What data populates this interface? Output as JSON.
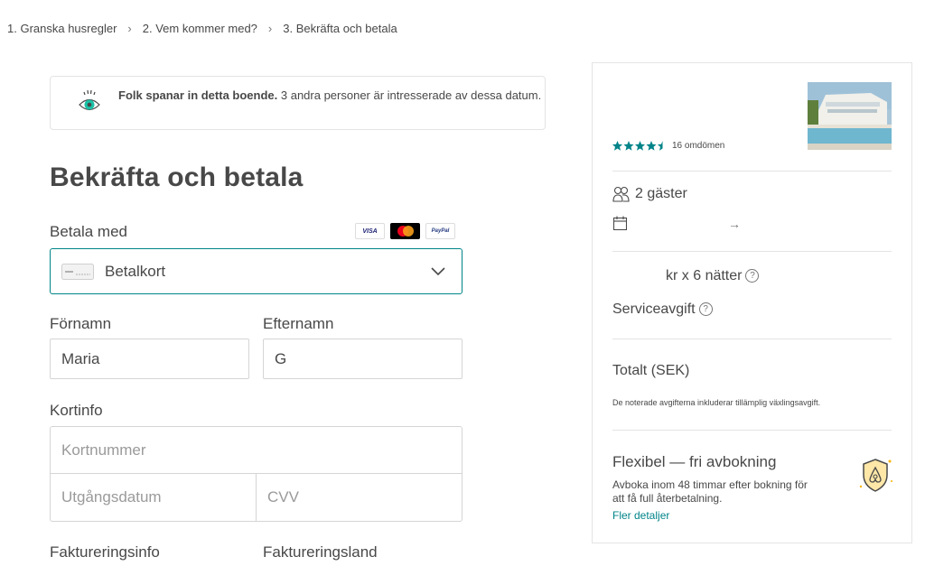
{
  "breadcrumbs": [
    "1. Granska husregler",
    "2. Vem kommer med?",
    "3. Bekräfta och betala"
  ],
  "notice": {
    "bold": "Folk spanar in detta boende.",
    "text": "3 andra personer är intresserade av dessa datum."
  },
  "page_title": "Bekräfta och betala",
  "payment": {
    "label": "Betala med",
    "card_logos": [
      "VISA",
      "Mastercard",
      "PayPal"
    ],
    "selected": "Betalkort"
  },
  "name": {
    "first_label": "Förnamn",
    "first_value": "Maria",
    "last_label": "Efternamn",
    "last_value": "G"
  },
  "card": {
    "label": "Kortinfo",
    "number_placeholder": "Kortnummer",
    "expiry_placeholder": "Utgångsdatum",
    "cvv_placeholder": "CVV"
  },
  "billing": {
    "info_label": "Faktureringsinfo",
    "country_label": "Faktureringsland"
  },
  "summary": {
    "rating_stars": 4.5,
    "reviews": "16 omdömen",
    "guests": "2 gäster",
    "arrow": "→",
    "price_line": "kr x 6 nätter",
    "service_fee": "Serviceavgift",
    "total": "Totalt (SEK)",
    "fee_note": "De noterade avgifterna inkluderar tillämplig växlingsavgift.",
    "flex_title": "Flexibel — fri avbokning",
    "flex_text": "Avboka inom 48 timmar efter bokning för att få full återbetalning.",
    "flex_link": "Fler detaljer",
    "help_glyph": "?"
  },
  "colors": {
    "teal": "#008489",
    "text": "#484848",
    "star": "#008489"
  }
}
